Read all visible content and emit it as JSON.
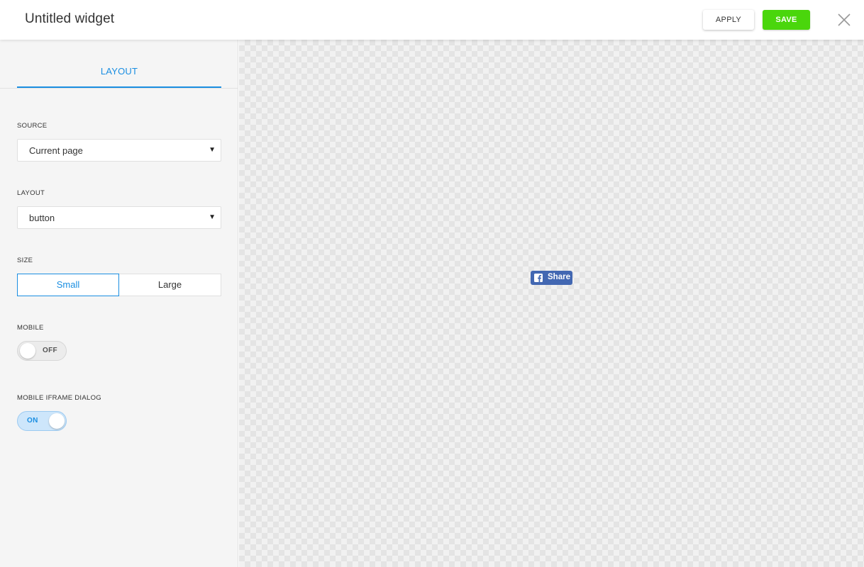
{
  "header": {
    "title": "Untitled widget",
    "apply_label": "APPLY",
    "save_label": "SAVE",
    "close_icon": "close-icon"
  },
  "sidebar": {
    "tabs": [
      {
        "label": "LAYOUT",
        "active": true
      }
    ],
    "source": {
      "label": "SOURCE",
      "value": "Current page",
      "caret": "▼"
    },
    "layout": {
      "label": "LAYOUT",
      "value": "button",
      "caret": "▼"
    },
    "size": {
      "label": "SIZE",
      "options": [
        "Small",
        "Large"
      ],
      "selected": "Small"
    },
    "mobile": {
      "label": "MOBILE",
      "state": "OFF"
    },
    "mobile_iframe": {
      "label": "MOBILE IFRAME DIALOG",
      "state": "ON"
    }
  },
  "preview": {
    "share_button": {
      "label": "Share",
      "icon": "facebook-icon"
    }
  },
  "colors": {
    "accent": "#1a8ee1",
    "save_green": "#4ad60c",
    "facebook_blue": "#4267b2"
  }
}
